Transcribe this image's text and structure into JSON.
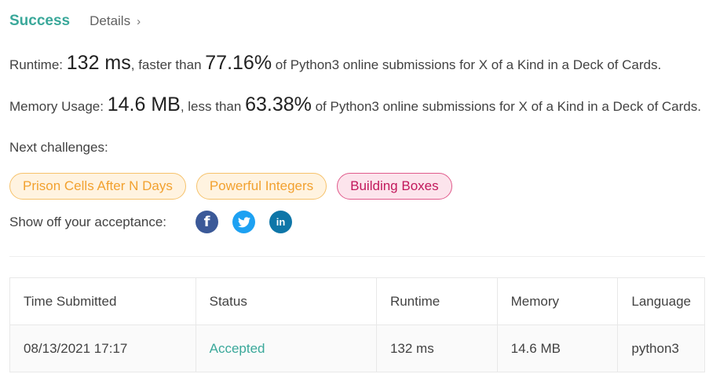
{
  "header": {
    "status": "Success",
    "details_label": "Details",
    "details_icon": "chevron-right-icon"
  },
  "runtime": {
    "label": "Runtime:",
    "value": "132 ms",
    "comparison": ", faster than",
    "percent": "77.16%",
    "suffix": "of Python3 online submissions for X of a Kind in a Deck of Cards."
  },
  "memory": {
    "label": "Memory Usage:",
    "value": "14.6 MB",
    "comparison": ", less than",
    "percent": "63.38%",
    "suffix": "of Python3 online submissions for X of a Kind in a Deck of Cards."
  },
  "next": {
    "label": "Next challenges:",
    "challenges": [
      {
        "label": "Prison Cells After N Days",
        "difficulty": "medium"
      },
      {
        "label": "Powerful Integers",
        "difficulty": "medium"
      },
      {
        "label": "Building Boxes",
        "difficulty": "hard"
      }
    ]
  },
  "share": {
    "label": "Show off your acceptance:",
    "icons": [
      "facebook-icon",
      "twitter-icon",
      "linkedin-icon"
    ]
  },
  "table": {
    "headers": [
      "Time Submitted",
      "Status",
      "Runtime",
      "Memory",
      "Language"
    ],
    "rows": [
      [
        "08/13/2021 17:17",
        "Accepted",
        "132 ms",
        "14.6 MB",
        "python3"
      ]
    ]
  },
  "colors": {
    "success": "#3aa89a",
    "medium_text": "#f2a12f",
    "hard_text": "#c2185b",
    "facebook": "#3b5998",
    "twitter": "#1da1f2",
    "linkedin": "#0e76a8"
  }
}
